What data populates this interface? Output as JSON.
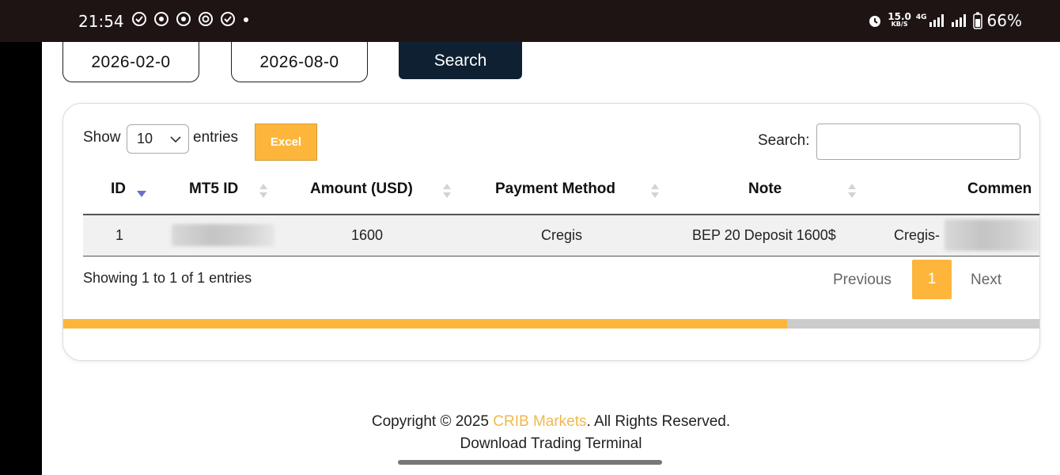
{
  "status_bar": {
    "time": "21:54",
    "speed_value": "15.0",
    "speed_unit": "KB/S",
    "network": "4G",
    "battery": "66%"
  },
  "filters": {
    "date_from": "2026-02-0",
    "date_to": "2026-08-0",
    "search_button": "Search"
  },
  "table_controls": {
    "show_label": "Show",
    "entries_value": "10",
    "entries_label": "entries",
    "excel_button": "Excel",
    "search_label": "Search:"
  },
  "table": {
    "columns": [
      "ID",
      "MT5 ID",
      "Amount (USD)",
      "Payment Method",
      "Note",
      "Commen"
    ],
    "rows": [
      {
        "id": "1",
        "amount": "1600",
        "payment_method": "Cregis",
        "note": "BEP 20 Deposit 1600$",
        "comment": "Cregis-"
      }
    ]
  },
  "pagination": {
    "info": "Showing 1 to 1 of 1 entries",
    "previous": "Previous",
    "current_page": "1",
    "next": "Next"
  },
  "horizontal_scroll_fraction": 0.74,
  "footer": {
    "copyright_prefix": "Copyright © 2025 ",
    "brand": "CRIB Markets",
    "copyright_suffix": ". All Rights Reserved.",
    "download": "Download Trading Terminal"
  },
  "colors": {
    "accent": "#fdb63b",
    "dark_button": "#0f2033",
    "sort_active": "#6c6ccf"
  }
}
